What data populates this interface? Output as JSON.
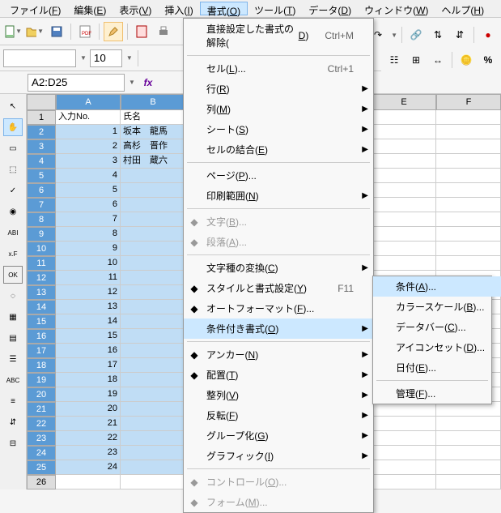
{
  "menubar": [
    {
      "label": "ファイル",
      "key": "F"
    },
    {
      "label": "編集",
      "key": "E"
    },
    {
      "label": "表示",
      "key": "V"
    },
    {
      "label": "挿入",
      "key": "I"
    },
    {
      "label": "書式",
      "key": "O",
      "active": true
    },
    {
      "label": "ツール",
      "key": "T"
    },
    {
      "label": "データ",
      "key": "D"
    },
    {
      "label": "ウィンドウ",
      "key": "W"
    },
    {
      "label": "ヘルプ",
      "key": "H"
    }
  ],
  "fontsize": "10",
  "namebox": "A2:D25",
  "columns": [
    {
      "label": "A",
      "w": 80,
      "sel": true
    },
    {
      "label": "B",
      "w": 80,
      "sel": true
    },
    {
      "label": "E",
      "w": 80,
      "sel": false
    },
    {
      "label": "F",
      "w": 80,
      "sel": false
    }
  ],
  "rows": [
    {
      "n": 1,
      "sel": false,
      "cells": [
        {
          "v": "入力No."
        },
        {
          "v": "氏名"
        }
      ]
    },
    {
      "n": 2,
      "sel": true,
      "cells": [
        {
          "v": "1",
          "num": true
        },
        {
          "v": "坂本　龍馬"
        }
      ]
    },
    {
      "n": 3,
      "sel": true,
      "cells": [
        {
          "v": "2",
          "num": true
        },
        {
          "v": "高杉　晋作"
        }
      ]
    },
    {
      "n": 4,
      "sel": true,
      "cells": [
        {
          "v": "3",
          "num": true
        },
        {
          "v": "村田　蔵六"
        }
      ]
    },
    {
      "n": 5,
      "sel": true,
      "cells": [
        {
          "v": "4",
          "num": true
        },
        {
          "v": ""
        }
      ]
    },
    {
      "n": 6,
      "sel": true,
      "cells": [
        {
          "v": "5",
          "num": true
        },
        {
          "v": ""
        }
      ]
    },
    {
      "n": 7,
      "sel": true,
      "cells": [
        {
          "v": "6",
          "num": true
        },
        {
          "v": ""
        }
      ]
    },
    {
      "n": 8,
      "sel": true,
      "cells": [
        {
          "v": "7",
          "num": true
        },
        {
          "v": ""
        }
      ]
    },
    {
      "n": 9,
      "sel": true,
      "cells": [
        {
          "v": "8",
          "num": true
        },
        {
          "v": ""
        }
      ]
    },
    {
      "n": 10,
      "sel": true,
      "cells": [
        {
          "v": "9",
          "num": true
        },
        {
          "v": ""
        }
      ]
    },
    {
      "n": 11,
      "sel": true,
      "cells": [
        {
          "v": "10",
          "num": true
        },
        {
          "v": ""
        }
      ]
    },
    {
      "n": 12,
      "sel": true,
      "cells": [
        {
          "v": "11",
          "num": true
        },
        {
          "v": ""
        }
      ]
    },
    {
      "n": 13,
      "sel": true,
      "cells": [
        {
          "v": "12",
          "num": true
        },
        {
          "v": ""
        }
      ]
    },
    {
      "n": 14,
      "sel": true,
      "cells": [
        {
          "v": "13",
          "num": true
        },
        {
          "v": ""
        }
      ]
    },
    {
      "n": 15,
      "sel": true,
      "cells": [
        {
          "v": "14",
          "num": true
        },
        {
          "v": ""
        }
      ]
    },
    {
      "n": 16,
      "sel": true,
      "cells": [
        {
          "v": "15",
          "num": true
        },
        {
          "v": ""
        }
      ]
    },
    {
      "n": 17,
      "sel": true,
      "cells": [
        {
          "v": "16",
          "num": true
        },
        {
          "v": ""
        }
      ]
    },
    {
      "n": 18,
      "sel": true,
      "cells": [
        {
          "v": "17",
          "num": true
        },
        {
          "v": ""
        }
      ]
    },
    {
      "n": 19,
      "sel": true,
      "cells": [
        {
          "v": "18",
          "num": true
        },
        {
          "v": ""
        }
      ]
    },
    {
      "n": 20,
      "sel": true,
      "cells": [
        {
          "v": "19",
          "num": true
        },
        {
          "v": ""
        }
      ]
    },
    {
      "n": 21,
      "sel": true,
      "cells": [
        {
          "v": "20",
          "num": true
        },
        {
          "v": ""
        }
      ]
    },
    {
      "n": 22,
      "sel": true,
      "cells": [
        {
          "v": "21",
          "num": true
        },
        {
          "v": ""
        }
      ]
    },
    {
      "n": 23,
      "sel": true,
      "cells": [
        {
          "v": "22",
          "num": true
        },
        {
          "v": ""
        }
      ]
    },
    {
      "n": 24,
      "sel": true,
      "cells": [
        {
          "v": "23",
          "num": true
        },
        {
          "v": ""
        }
      ]
    },
    {
      "n": 25,
      "sel": true,
      "cells": [
        {
          "v": "24",
          "num": true
        },
        {
          "v": ""
        }
      ]
    },
    {
      "n": 26,
      "sel": false,
      "cells": [
        {
          "v": ""
        },
        {
          "v": ""
        }
      ]
    }
  ],
  "format_menu": [
    {
      "label": "直接設定した書式の解除",
      "key": "D",
      "shortcut": "Ctrl+M"
    },
    {
      "sep": true
    },
    {
      "label": "セル",
      "key": "L",
      "ell": true,
      "shortcut": "Ctrl+1"
    },
    {
      "label": "行",
      "key": "R",
      "sub": true
    },
    {
      "label": "列",
      "key": "M",
      "sub": true
    },
    {
      "label": "シート",
      "key": "S",
      "sub": true
    },
    {
      "label": "セルの結合",
      "key": "E",
      "sub": true
    },
    {
      "sep": true
    },
    {
      "label": "ページ",
      "key": "P",
      "ell": true
    },
    {
      "label": "印刷範囲",
      "key": "N",
      "sub": true
    },
    {
      "sep": true
    },
    {
      "label": "文字",
      "key": "B",
      "ell": true,
      "disabled": true,
      "icon": "a"
    },
    {
      "label": "段落",
      "key": "A",
      "ell": true,
      "disabled": true,
      "icon": "para"
    },
    {
      "sep": true
    },
    {
      "label": "文字種の変換",
      "key": "C",
      "sub": true
    },
    {
      "label": "スタイルと書式設定",
      "key": "Y",
      "shortcut": "F11",
      "icon": "style"
    },
    {
      "label": "オートフォーマット",
      "key": "F",
      "ell": true,
      "icon": "auto"
    },
    {
      "label": "条件付き書式",
      "key": "O",
      "sub": true,
      "hover": true
    },
    {
      "sep": true
    },
    {
      "label": "アンカー",
      "key": "N",
      "sub": true,
      "icon": "anchor"
    },
    {
      "label": "配置",
      "key": "T",
      "sub": true,
      "icon": "align"
    },
    {
      "label": "整列",
      "key": "V",
      "sub": true
    },
    {
      "label": "反転",
      "key": "F",
      "sub": true
    },
    {
      "label": "グループ化",
      "key": "G",
      "sub": true
    },
    {
      "label": "グラフィック",
      "key": "I",
      "sub": true
    },
    {
      "sep": true
    },
    {
      "label": "コントロール",
      "key": "O",
      "ell": true,
      "disabled": true,
      "icon": "ctrl"
    },
    {
      "label": "フォーム",
      "key": "M",
      "ell": true,
      "disabled": true,
      "icon": "form"
    }
  ],
  "submenu": [
    {
      "label": "条件",
      "key": "A",
      "ell": true,
      "hover": true
    },
    {
      "label": "カラースケール",
      "key": "B",
      "ell": true
    },
    {
      "label": "データバー",
      "key": "C",
      "ell": true
    },
    {
      "label": "アイコンセット",
      "key": "D",
      "ell": true
    },
    {
      "label": "日付",
      "key": "E",
      "ell": true
    },
    {
      "sep": true
    },
    {
      "label": "管理",
      "key": "F",
      "ell": true
    }
  ]
}
